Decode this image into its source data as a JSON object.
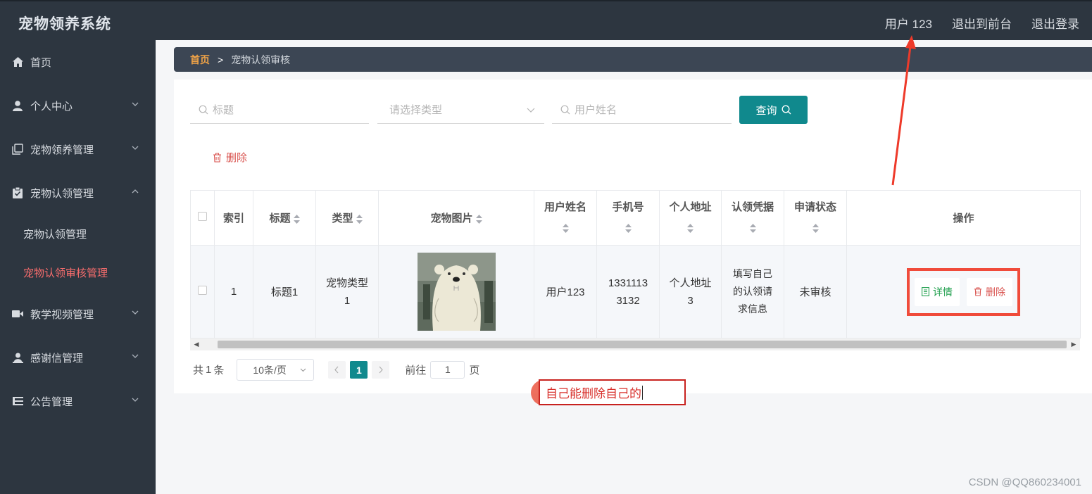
{
  "app": {
    "title": "宠物领养系统"
  },
  "top_nav": {
    "user": "用户 123",
    "to_front": "退出到前台",
    "logout": "退出登录"
  },
  "sidebar": {
    "items": [
      {
        "label": "首页",
        "icon": "home-icon"
      },
      {
        "label": "个人中心",
        "icon": "user-icon",
        "expanded": false
      },
      {
        "label": "宠物领养管理",
        "icon": "copy-icon",
        "expanded": false
      },
      {
        "label": "宠物认领管理",
        "icon": "clipboard-check-icon",
        "expanded": true
      },
      {
        "label": "教学视频管理",
        "icon": "video-icon",
        "expanded": false
      },
      {
        "label": "感谢信管理",
        "icon": "user-icon",
        "expanded": false
      },
      {
        "label": "公告管理",
        "icon": "list-icon",
        "expanded": false
      }
    ],
    "sub_items": [
      {
        "label": "宠物认领管理",
        "active": false
      },
      {
        "label": "宠物认领审核管理",
        "active": true
      }
    ]
  },
  "breadcrumb": {
    "home": "首页",
    "separator": ">",
    "current": "宠物认领审核"
  },
  "search": {
    "title_placeholder": "标题",
    "type_placeholder": "请选择类型",
    "username_placeholder": "用户姓名",
    "query_label": "查询"
  },
  "actions": {
    "delete_label": "删除"
  },
  "table": {
    "headers": {
      "index": "索引",
      "title": "标题",
      "type": "类型",
      "pet_image": "宠物图片",
      "username": "用户姓名",
      "phone": "手机号",
      "address": "个人地址",
      "proof": "认领凭据",
      "status": "申请状态",
      "ops": "操作"
    },
    "rows": [
      {
        "index": "1",
        "title": "标题1",
        "type_line1": "宠物类型",
        "type_line2": "1",
        "username": "用户123",
        "phone_line1": "1331113",
        "phone_line2": "3132",
        "address_line1": "个人地址",
        "address_line2": "3",
        "proof_line1": "填写自己",
        "proof_line2": "的认领请",
        "proof_line3": "求信息",
        "status": "未审核",
        "detail_label": "详情",
        "delete_label": "删除"
      }
    ]
  },
  "pagination": {
    "total_prefix": "共",
    "total": "1",
    "total_suffix": "条",
    "page_size": "10条/页",
    "current_page": "1",
    "goto_label": "前往",
    "goto_value": "1",
    "page_suffix": "页"
  },
  "annotation": {
    "text": "自己能删除自己的"
  },
  "watermark": "CSDN @QQ860234001",
  "colors": {
    "accent": "#10898d",
    "danger": "#d9534f",
    "active_menu": "#f56c6c",
    "sidebar_bg": "#2d3640",
    "annotation_red": "#f04b3a"
  }
}
